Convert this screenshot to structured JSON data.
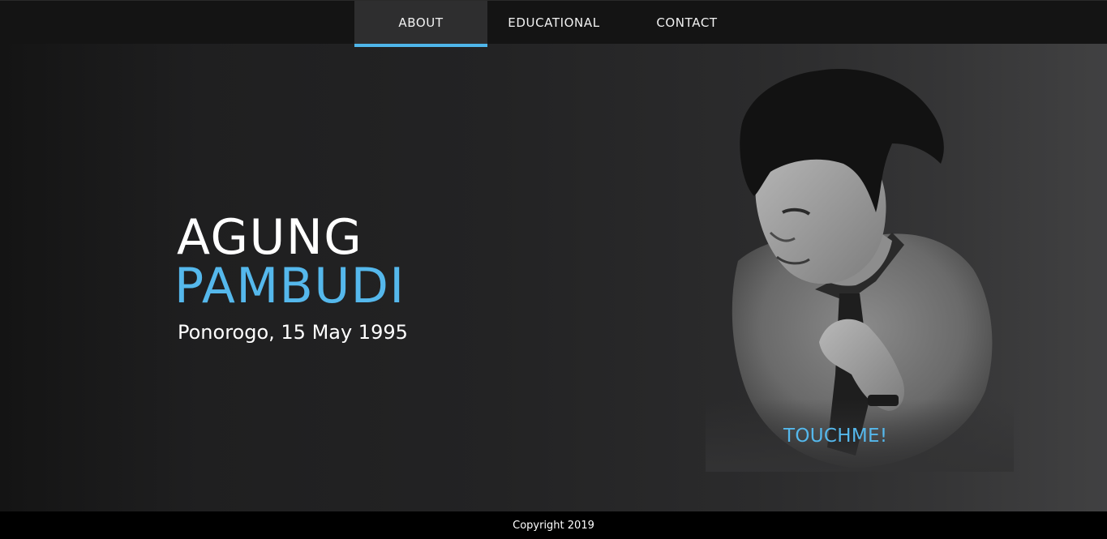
{
  "nav": {
    "items": [
      {
        "label": "ABOUT",
        "active": true
      },
      {
        "label": "EDUCATIONAL",
        "active": false
      },
      {
        "label": "CONTACT",
        "active": false
      }
    ]
  },
  "hero": {
    "first_name": "AGUNG",
    "last_name": "PAMBUDI",
    "birth_info": "Ponorogo, 15 May 1995",
    "touchme_label": "TOUCHME!"
  },
  "footer": {
    "copyright": "Copyright 2019"
  },
  "colors": {
    "accent": "#55b8ec",
    "nav_background": "#141414",
    "active_tab_background": "#2e2e2f",
    "footer_background": "#000000",
    "text": "#ffffff"
  },
  "portrait": {
    "subject": "grayscale photo of a man in a dark shirt and tie, viewed from above"
  }
}
